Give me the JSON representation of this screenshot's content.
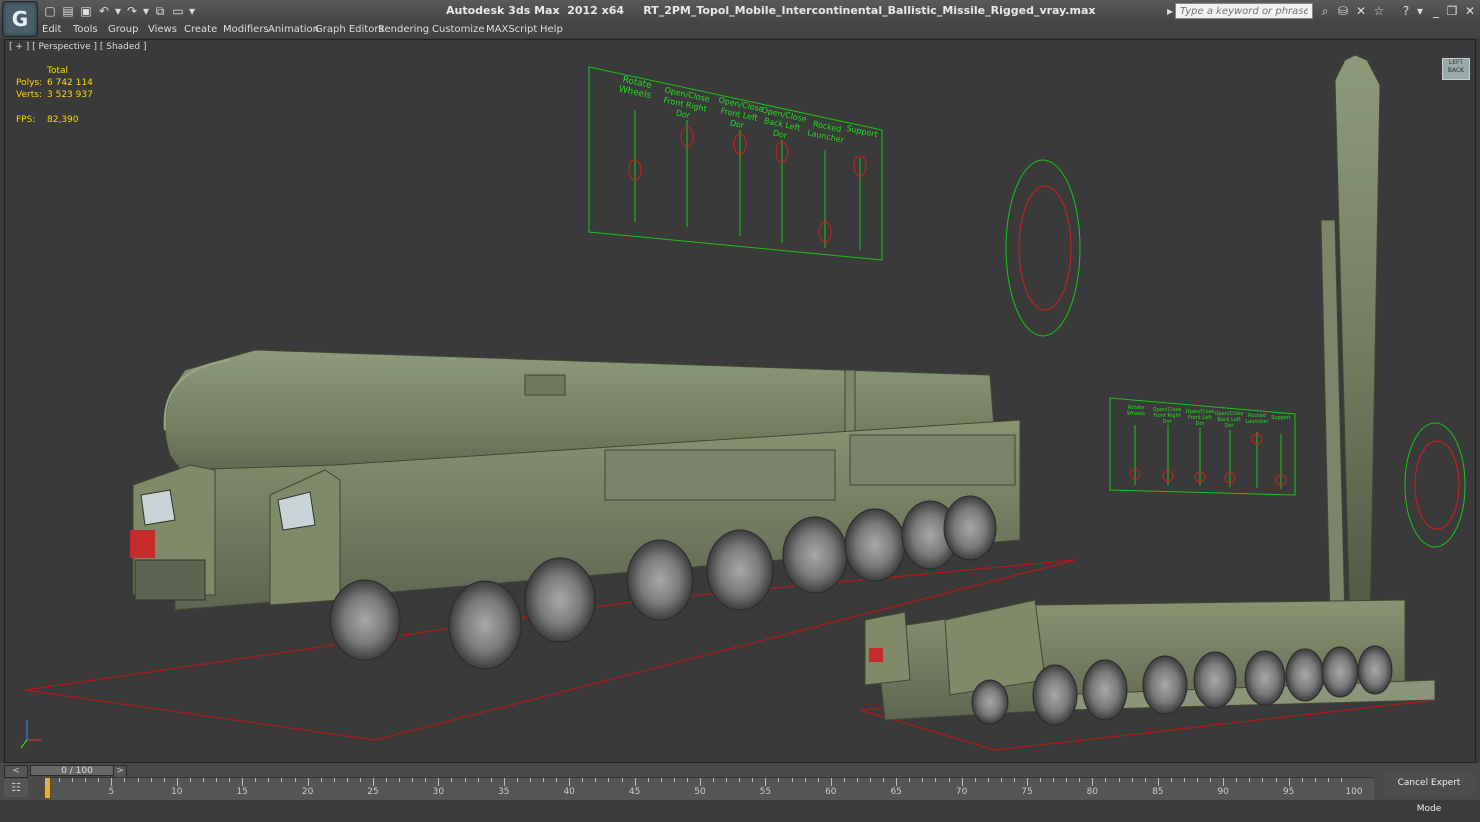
{
  "app": {
    "window_title": "Autodesk 3ds Max  2012 x64     RT_2PM_Topol_Mobile_Intercontinental_Ballistic_Missile_Rigged_vray.max",
    "logo_letter": "G"
  },
  "search": {
    "placeholder": "Type a keyword or phrase"
  },
  "menu": [
    "Edit",
    "Tools",
    "Group",
    "Views",
    "Create",
    "Modifiers",
    "Animation",
    "Graph Editors",
    "Rendering",
    "Customize",
    "MAXScript",
    "Help"
  ],
  "viewport": {
    "label": "[ + ] [ Perspective ] [ Shaded ]",
    "stats": {
      "total_label": "Total",
      "polys_label": "Polys:",
      "polys_value": "6 742 114",
      "verts_label": "Verts:",
      "verts_value": "3 523 937",
      "fps_label": "FPS:",
      "fps_value": "82,390"
    },
    "viewcube_text": "LEFT BACK"
  },
  "controls_big": [
    "Rotate Wheels",
    "Open/Close Front Right Dor",
    "Open/Close Front Left Dor",
    "Open/Close Back Left Dor",
    "Rocked Launcher",
    "Support"
  ],
  "controls_small": [
    "Rotate Wheels",
    "Open/Close Front Right Dor",
    "Open/Close Front Left Dor",
    "Open/Close Back Left Dor",
    "Rocked Launcher",
    "Support"
  ],
  "timeline": {
    "slider_text": "0 / 100",
    "ticks": [
      "0",
      "5",
      "10",
      "15",
      "20",
      "25",
      "30",
      "35",
      "40",
      "45",
      "50",
      "55",
      "60",
      "65",
      "70",
      "75",
      "80",
      "85",
      "90",
      "95",
      "100"
    ],
    "expert_button": "Cancel Expert Mode"
  },
  "colors": {
    "ui_bg": "#3b3b3b",
    "gizmo_green": "#00ff33",
    "gizmo_red": "#d61b1b",
    "vehicle_olive": "#7e8a6a"
  }
}
